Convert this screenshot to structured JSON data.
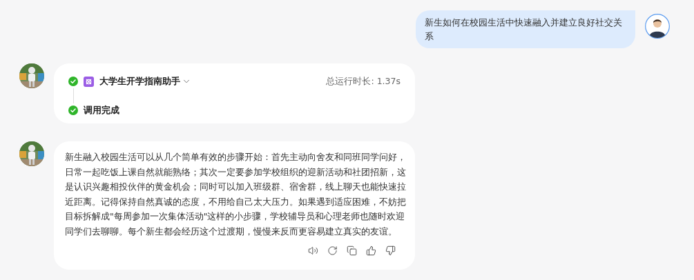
{
  "user_message": {
    "text": "新生如何在校园生活中快速融入并建立良好社交关系"
  },
  "run_card": {
    "steps": [
      {
        "kind": "plugin",
        "label": "大学生开学指南助手",
        "done": true
      },
      {
        "kind": "result",
        "label": "调用完成",
        "done": true
      }
    ],
    "runtime": "总运行时长: 1.37s"
  },
  "answer": {
    "text": "新生融入校园生活可以从几个简单有效的步骤开始：首先主动向舍友和同班同学问好，日常一起吃饭上课自然就能熟络；其次一定要参加学校组织的迎新活动和社团招新，这是认识兴趣相投伙伴的黄金机会；同时可以加入班级群、宿舍群，线上聊天也能快速拉近距离。记得保持自然真诚的态度，不用给自己太大压力。如果遇到适应困难，不妨把目标拆解成\"每周参加一次集体活动\"这样的小步骤，学校辅导员和心理老师也随时欢迎同学们去聊聊。每个新生都会经历这个过渡期，慢慢来反而更容易建立真实的友谊。"
  }
}
